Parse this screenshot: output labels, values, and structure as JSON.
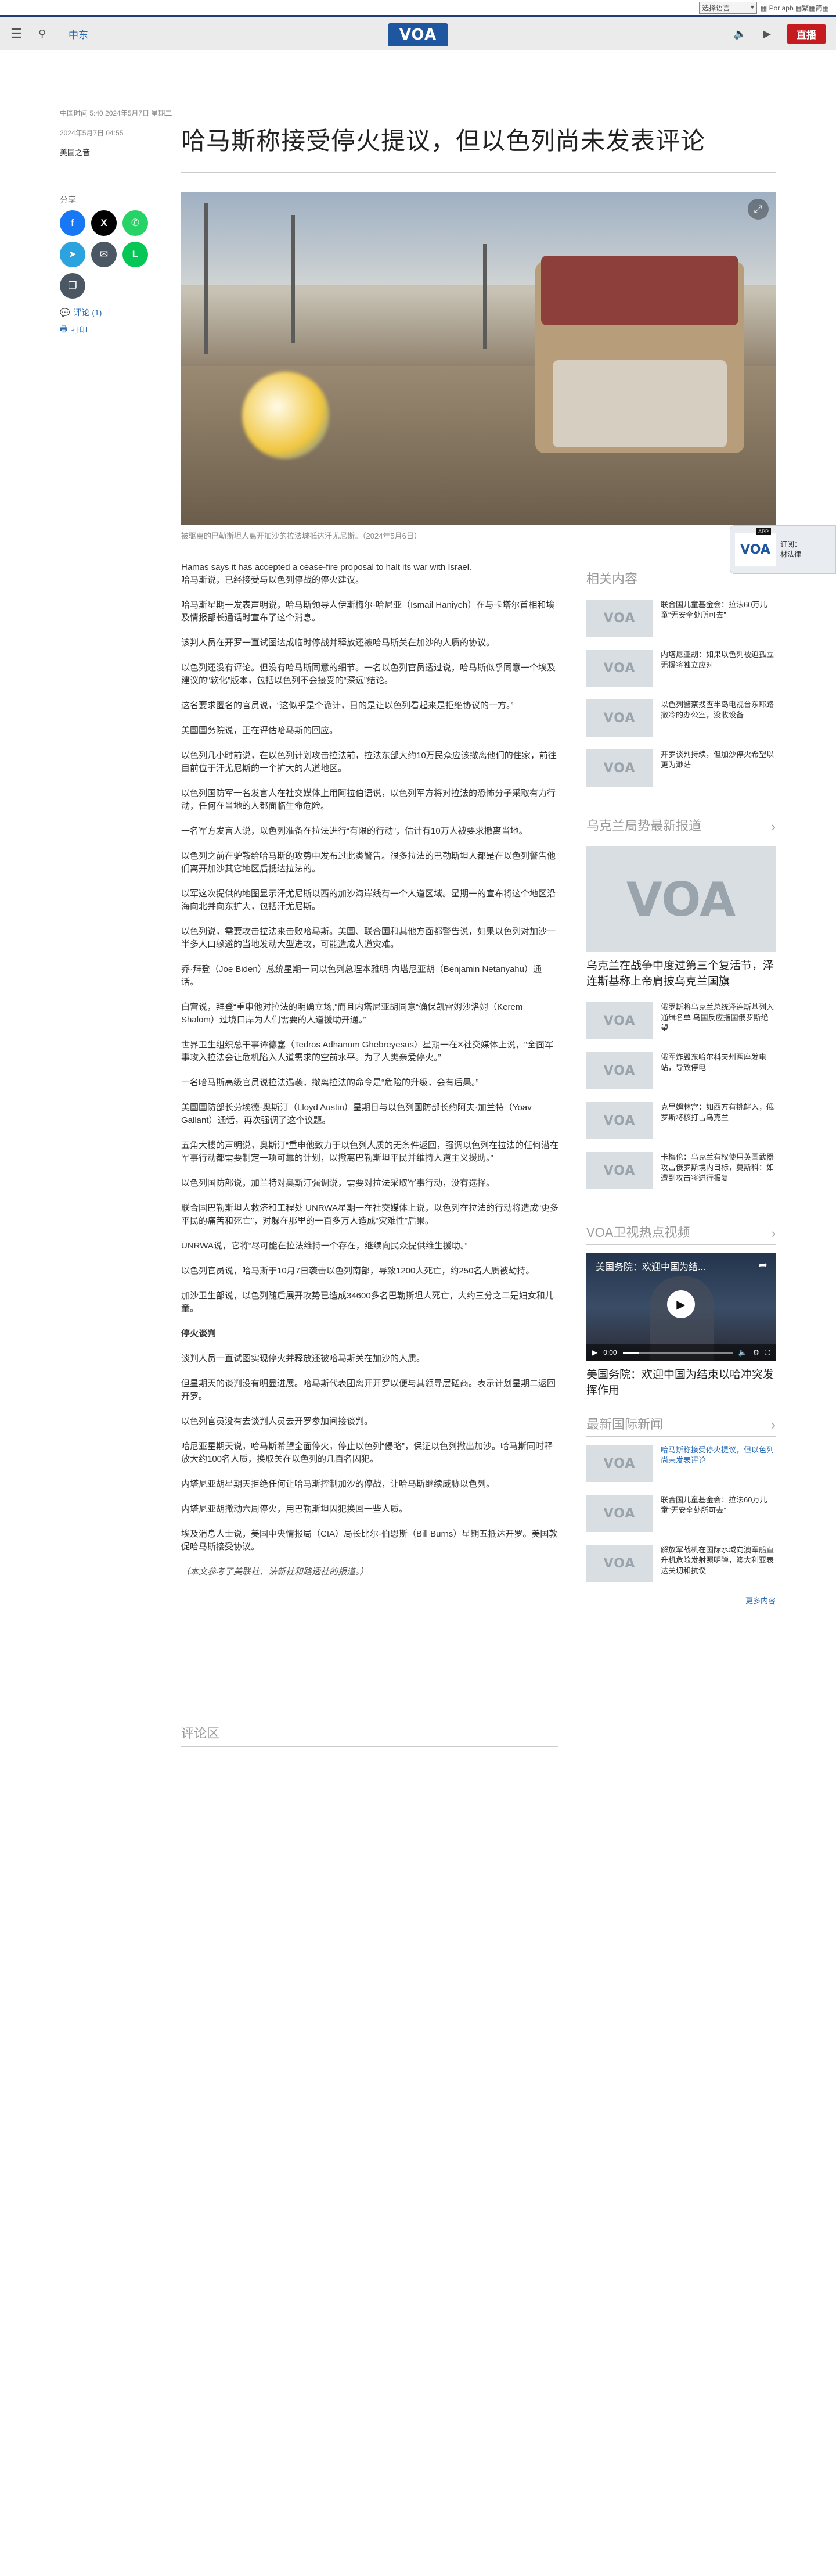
{
  "util": {
    "lang_select": "选择语言",
    "lang_links": "▦ Por apb ▦繁▦简▦"
  },
  "header": {
    "menu_icon": "hamburger-icon",
    "search_icon": "search-icon",
    "region": "中东",
    "logo_text": "VOA",
    "live_label": "直播"
  },
  "article": {
    "dateline_1": "中国时间 5:40 2024年5月7日 星期二",
    "dateline_2": "2024年5月7日 04:55",
    "byline": "美国之音",
    "title": "哈马斯称接受停火提议，但以色列尚未发表评论",
    "share_label": "分享",
    "comments_link": "评论 (1)",
    "print_link": "打印",
    "caption": "被驱离的巴勒斯坦人离开加沙的拉法城抵达汗尤尼斯。（2024年5月6日）",
    "paragraphs": [
      "Hamas says it has accepted a cease-fire proposal to halt its war with Israel.\n哈马斯说，已经接受与以色列停战的停火建议。",
      "哈马斯星期一发表声明说，哈马斯领导人伊斯梅尔·哈尼亚（Ismail Haniyeh）在与卡塔尔首相和埃及情报部长通话时宣布了这个消息。",
      "该判人员在开罗一直试图达成临时停战并释放还被哈马斯关在加沙的人质的协议。",
      "以色列还没有评论。但没有哈马斯同意的细节。一名以色列官员透过说，哈马斯似乎同意一个埃及建议的“软化”版本，包括以色列不会接受的“深远”结论。",
      "这名要求匿名的官员说，“这似乎是个诡计，目的是让以色列看起来是拒绝协议的一方。”",
      "美国国务院说，正在评估哈马斯的回应。",
      "以色列几小时前说，在以色列计划攻击拉法前，拉法东部大约10万民众应该撤离他们的住家，前往目前位于汗尤尼斯的一个扩大的人道地区。",
      "以色列国防军一名发言人在社交媒体上用阿拉伯语说，以色列军方将对拉法的恐怖分子采取有力行动，任何在当地的人都面临生命危险。",
      "一名军方发言人说，以色列准备在拉法进行“有限的行动”，估计有10万人被要求撤离当地。",
      "以色列之前在驴鞍给哈马斯的攻势中发布过此类警告。很多拉法的巴勒斯坦人都是在以色列警告他们离开加沙其它地区后抵达拉法的。",
      "以军这次提供的地图显示汗尤尼斯以西的加沙海岸线有一个人道区域。星期一的宣布将这个地区沿海向北并向东扩大，包括汗尤尼斯。",
      "以色列说，需要攻击拉法来击败哈马斯。美国、联合国和其他方面都警告说，如果以色列对加沙一半多人口躲避的当地发动大型进攻，可能造成人道灾难。",
      "乔·拜登（Joe Biden）总统星期一同以色列总理本雅明·内塔尼亚胡（Benjamin Netanyahu）通话。",
      "白宫说，拜登“重申他对拉法的明确立场,”而且内塔尼亚胡同意“确保凯雷姆沙洛姆（Kerem Shalom）过境口岸为人们需要的人道援助开通。”",
      "世界卫生组织总干事谭德塞（Tedros Adhanom Ghebreyesus）星期一在X社交媒体上说，“全面军事攻入拉法会让危机陷入人道需求的空前水平。为了人类亲爱停火。”",
      "一名哈马斯高级官员说拉法遇袭，撤离拉法的命令是“危险的升级，会有后果。”",
      "美国国防部长劳埃德·奥斯汀（Lloyd Austin）星期日与以色列国防部长约阿夫·加兰特（Yoav Gallant）通话，再次强调了这个议题。",
      "五角大楼的声明说，奥斯汀“重申他致力于以色列人质的无条件返回，强调以色列在拉法的任何潜在军事行动都需要制定一项可靠的计划，以撤离巴勒斯坦平民并维持人道主义援助。”",
      "以色列国防部说，加兰特对奥斯汀强调说，需要对拉法采取军事行动，没有选择。",
      "联合国巴勒斯坦人救济和工程处 UNRWA星期一在社交媒体上说，以色列在拉法的行动将造成“更多平民的痛苦和死亡”，对躲在那里的一百多万人造成“灾难性”后果。",
      "UNRWA说，它将“尽可能在拉法维持一个存在，继续向民众提供维生援助。”",
      "以色列官员说，哈马斯于10月7日袭击以色列南部，导致1200人死亡，约250名人质被劫持。",
      "加沙卫生部说，以色列随后展开攻势已造成34600多名巴勒斯坦人死亡，大约三分之二是妇女和儿童。"
    ],
    "subhead": "停火谈判",
    "paragraphs_2": [
      "谈判人员一直试图实现停火并释放还被哈马斯关在加沙的人质。",
      "但星期天的谈判没有明显进展。哈马斯代表团离开开罗以便与其领导层磋商。表示计划星期二返回开罗。",
      "以色列官员没有去谈判人员去开罗参加间接谈判。",
      "哈尼亚星期天说，哈马斯希望全面停火，停止以色列“侵略”，保证以色列撤出加沙。哈马斯同时释放大约100名人质，换取关在以色列的几百名囚犯。",
      "内塔尼亚胡星期天拒绝任何让哈马斯控制加沙的停战，让哈马斯继续威胁以色列。",
      "内塔尼亚胡撤动六周停火，用巴勒斯坦囚犯换回一些人质。",
      "埃及消息人士说，美国中央情报局（CIA）局长比尔·伯恩斯（Bill Burns）星期五抵达开罗。美国敦促哈马斯接受协议。"
    ],
    "note": "（本文参考了美联社、法新社和路透社的报道。）",
    "comments_heading": "评论区"
  },
  "rail": {
    "related_heading": "相关内容",
    "related": [
      "联合国儿童基金会：拉法60万儿童“无安全处所可去”",
      "内塔尼亚胡：如果以色列被迫孤立无援将独立应对",
      "以色列警察搜查半岛电视台东耶路撒冷的办公室，没收设备",
      "开罗谈判持续，但加沙停火希望以更为渺茫"
    ],
    "ukraine_heading": "乌克兰局势最新报道",
    "ukraine_big_title": "乌克兰在战争中度过第三个复活节，泽连斯基称上帝肩披乌克兰国旗",
    "ukraine_items": [
      "俄罗斯将乌克兰总统泽连斯基列入通缉名单 乌国反应指国俄罗斯绝望",
      "俄军炸毁东哈尔科夫州两座发电站，导致停电",
      "克里姆林宫：如西方有挑衅入，俄罗斯将核打击乌克兰",
      "卡梅伦：乌克兰有权使用英国武器攻击俄罗斯境内目标，莫斯科：如遭到攻击将进行报复"
    ],
    "video_heading": "VOA卫视热点视频",
    "video_overlay_title": "美国务院：欢迎中国为结...",
    "video_time": "0:00",
    "video_progress": 0.15,
    "video_title": "美国务院：欢迎中国为结束以哈冲突发挥作用",
    "intl_heading": "最新国际新闻",
    "intl_items": [
      "哈马斯称接受停火提议，但以色列尚未发表评论",
      "联合国儿童基金会：拉法60万儿童“无安全处所可去”",
      "解放军战机在国际水域向澳军船直升机危险发射照明弹，澳大利亚表达关切和抗议"
    ],
    "more_link": "更多内容"
  },
  "sticky": {
    "badge": "APP",
    "text_1": "订阅：",
    "text_2": "材法律"
  },
  "colors": {
    "brand": "#1f56a0",
    "live": "#c51a1f",
    "link": "#2a6bb5"
  }
}
